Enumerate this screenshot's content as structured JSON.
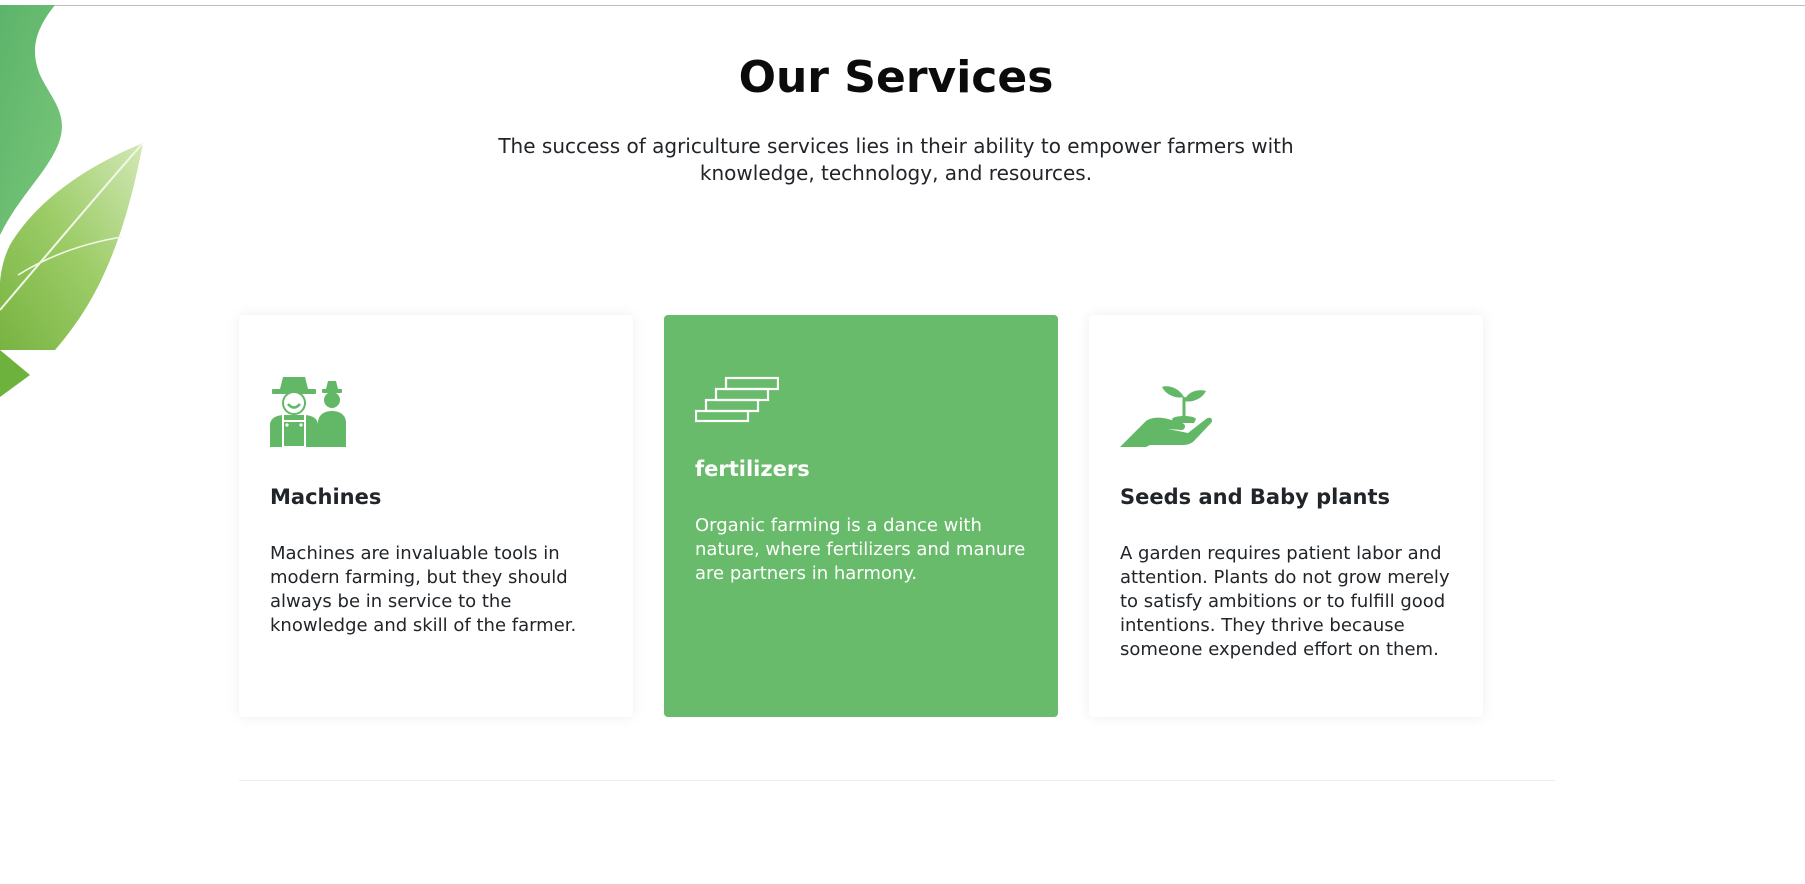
{
  "section": {
    "title": "Our Services",
    "subtitle": "The success of agriculture services lies in their ability to empower farmers with knowledge, technology, and resources."
  },
  "cards": [
    {
      "icon": "farmers-icon",
      "title": "Machines",
      "text": "Machines are invaluable tools in modern farming, but they should always be in service to the knowledge and skill of the farmer.",
      "highlighted": false
    },
    {
      "icon": "stairs-icon",
      "title": "fertilizers",
      "text": "Organic farming is a dance with nature, where fertilizers and manure are partners in harmony.",
      "highlighted": true
    },
    {
      "icon": "hand-plant-icon",
      "title": "Seeds and Baby plants",
      "text": "A garden requires patient labor and attention. Plants do not grow merely to satisfy ambitions or to fulfill good intentions. They thrive because someone expended effort on them.",
      "highlighted": false
    }
  ],
  "colors": {
    "accent": "#68bb6a",
    "icon": "#62b866",
    "title": "#0b0b0b",
    "text": "#212529"
  }
}
